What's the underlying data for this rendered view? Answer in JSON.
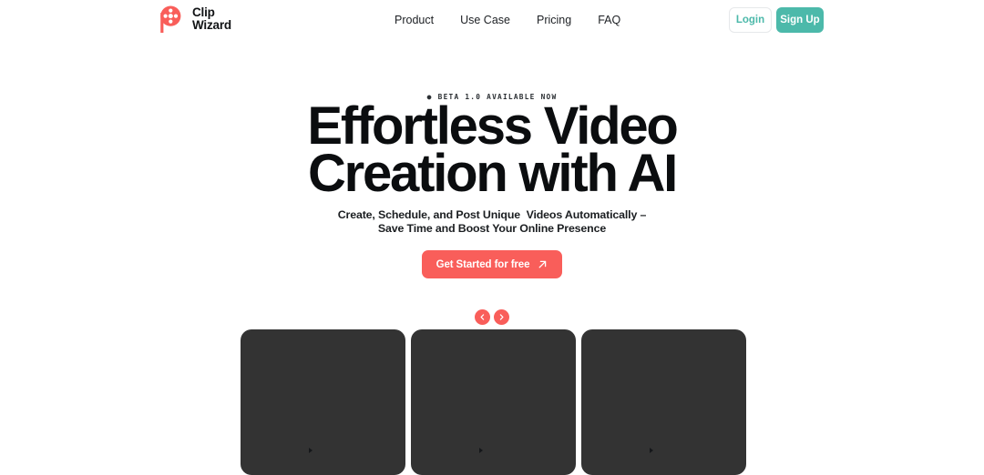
{
  "brand": {
    "icon": "film-reel-icon",
    "line1": "Clip",
    "line2": "Wizard",
    "color": "#f95e5a"
  },
  "nav": {
    "items": [
      {
        "label": "Product"
      },
      {
        "label": "Use Case"
      },
      {
        "label": "Pricing"
      },
      {
        "label": "FAQ"
      }
    ]
  },
  "auth": {
    "login_label": "Login",
    "signup_label": "Sign Up",
    "accent_color": "#4cb9aa"
  },
  "hero": {
    "badge": "BETA 1.0 AVAILABLE NOW",
    "badge_dot": "●",
    "headline_line1": "Effortless Video",
    "headline_line2": "Creation with AI",
    "subhead": "Create, Schedule, and Post Unique  Videos Automatically –\nSave Time and Boost Your Online Presence",
    "cta_label": "Get Started for free",
    "cta_icon": "arrow-up-right-icon",
    "cta_color": "#f95e5a"
  },
  "carousel": {
    "prev_icon": "chevron-left-icon",
    "next_icon": "chevron-right-icon",
    "button_color": "#f95e5a",
    "cards": [
      {
        "id": "video-card-1",
        "background": "#333333"
      },
      {
        "id": "video-card-2",
        "background": "#333333"
      },
      {
        "id": "video-card-3",
        "background": "#333333"
      }
    ]
  }
}
